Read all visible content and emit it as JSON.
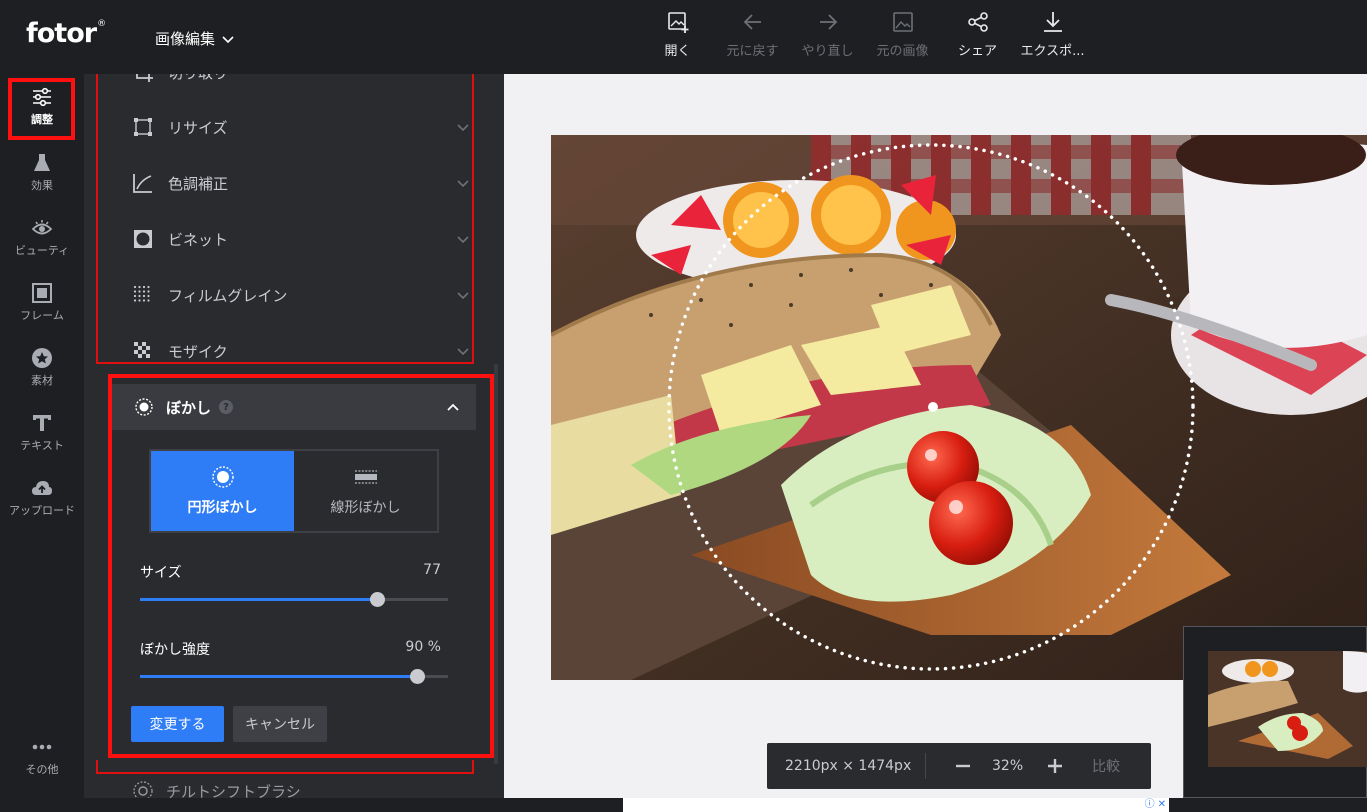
{
  "app": {
    "logo": "fotor",
    "logo_mark": "®",
    "mode": "画像編集"
  },
  "toolbar": [
    {
      "name": "open",
      "label": "開く",
      "icon": "image-add-icon",
      "enabled": true
    },
    {
      "name": "undo",
      "label": "元に戻す",
      "icon": "arrow-left-icon",
      "enabled": false
    },
    {
      "name": "redo",
      "label": "やり直し",
      "icon": "arrow-right-icon",
      "enabled": false
    },
    {
      "name": "original",
      "label": "元の画像",
      "icon": "image-icon",
      "enabled": false
    },
    {
      "name": "share",
      "label": "シェア",
      "icon": "share-icon",
      "enabled": true
    },
    {
      "name": "export",
      "label": "エクスポ...",
      "icon": "download-icon",
      "enabled": true
    }
  ],
  "rail": {
    "items": [
      {
        "label": "調整",
        "icon": "sliders-icon"
      },
      {
        "label": "効果",
        "icon": "flask-icon"
      },
      {
        "label": "ビューティ",
        "icon": "eye-icon"
      },
      {
        "label": "フレーム",
        "icon": "frame-icon"
      },
      {
        "label": "素材",
        "icon": "star-badge-icon"
      },
      {
        "label": "テキスト",
        "icon": "text-icon"
      },
      {
        "label": "アップロード",
        "icon": "cloud-upload-icon"
      }
    ],
    "more_label": "その他"
  },
  "panel": {
    "partial_top_label": "切り取り",
    "tools": [
      {
        "label": "リサイズ",
        "icon": "resize-icon"
      },
      {
        "label": "色調補正",
        "icon": "curve-icon"
      },
      {
        "label": "ビネット",
        "icon": "vignette-icon"
      },
      {
        "label": "フィルムグレイン",
        "icon": "grain-icon"
      },
      {
        "label": "モザイク",
        "icon": "mosaic-icon"
      }
    ],
    "blur": {
      "title": "ぼかし",
      "help": "?",
      "modes": [
        {
          "label": "円形ぼかし",
          "selected": true
        },
        {
          "label": "線形ぼかし",
          "selected": false
        }
      ],
      "size": {
        "label": "サイズ",
        "value": "77",
        "level": 0.77
      },
      "strength": {
        "label": "ぼかし強度",
        "value": "90 %",
        "level": 0.9
      },
      "apply_label": "変更する",
      "cancel_label": "キャンセル"
    },
    "next_tool_label": "チルトシフトブラシ"
  },
  "canvas": {
    "dimensions": "2210px × 1474px",
    "zoom": "32%",
    "compare_label": "比較"
  },
  "colors": {
    "accent": "#2f7df6",
    "highlight": "#ff1010",
    "panel_bg": "#2a2b2f",
    "app_bg": "#1e1f22"
  }
}
